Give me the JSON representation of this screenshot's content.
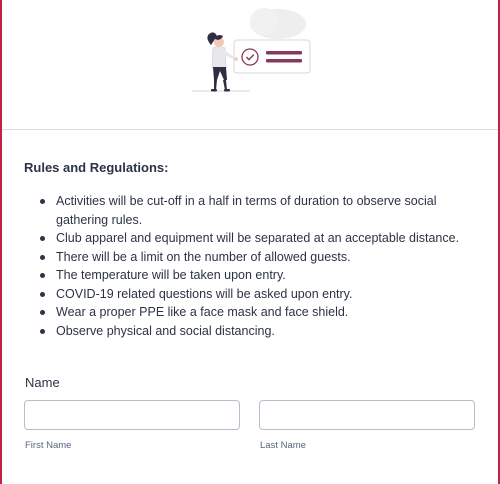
{
  "header": {
    "illustration": "person-with-checklist-illustration",
    "colors": {
      "accent": "#8a3a5c",
      "frame_border": "#c4204a"
    }
  },
  "rules": {
    "title": "Rules and Regulations:",
    "items": [
      "Activities will be cut-off in a half in terms of duration to observe social gathering rules.",
      "Club apparel and equipment will be separated at an acceptable distance.",
      "There will be a limit on the number of allowed guests.",
      "The temperature will be taken upon entry.",
      "COVID-19 related questions will be asked upon entry.",
      "Wear a proper PPE like a face mask and face shield.",
      "Observe physical and social distancing."
    ]
  },
  "name_field": {
    "label": "Name",
    "first": {
      "value": "",
      "sublabel": "First Name"
    },
    "last": {
      "value": "",
      "sublabel": "Last Name"
    }
  }
}
